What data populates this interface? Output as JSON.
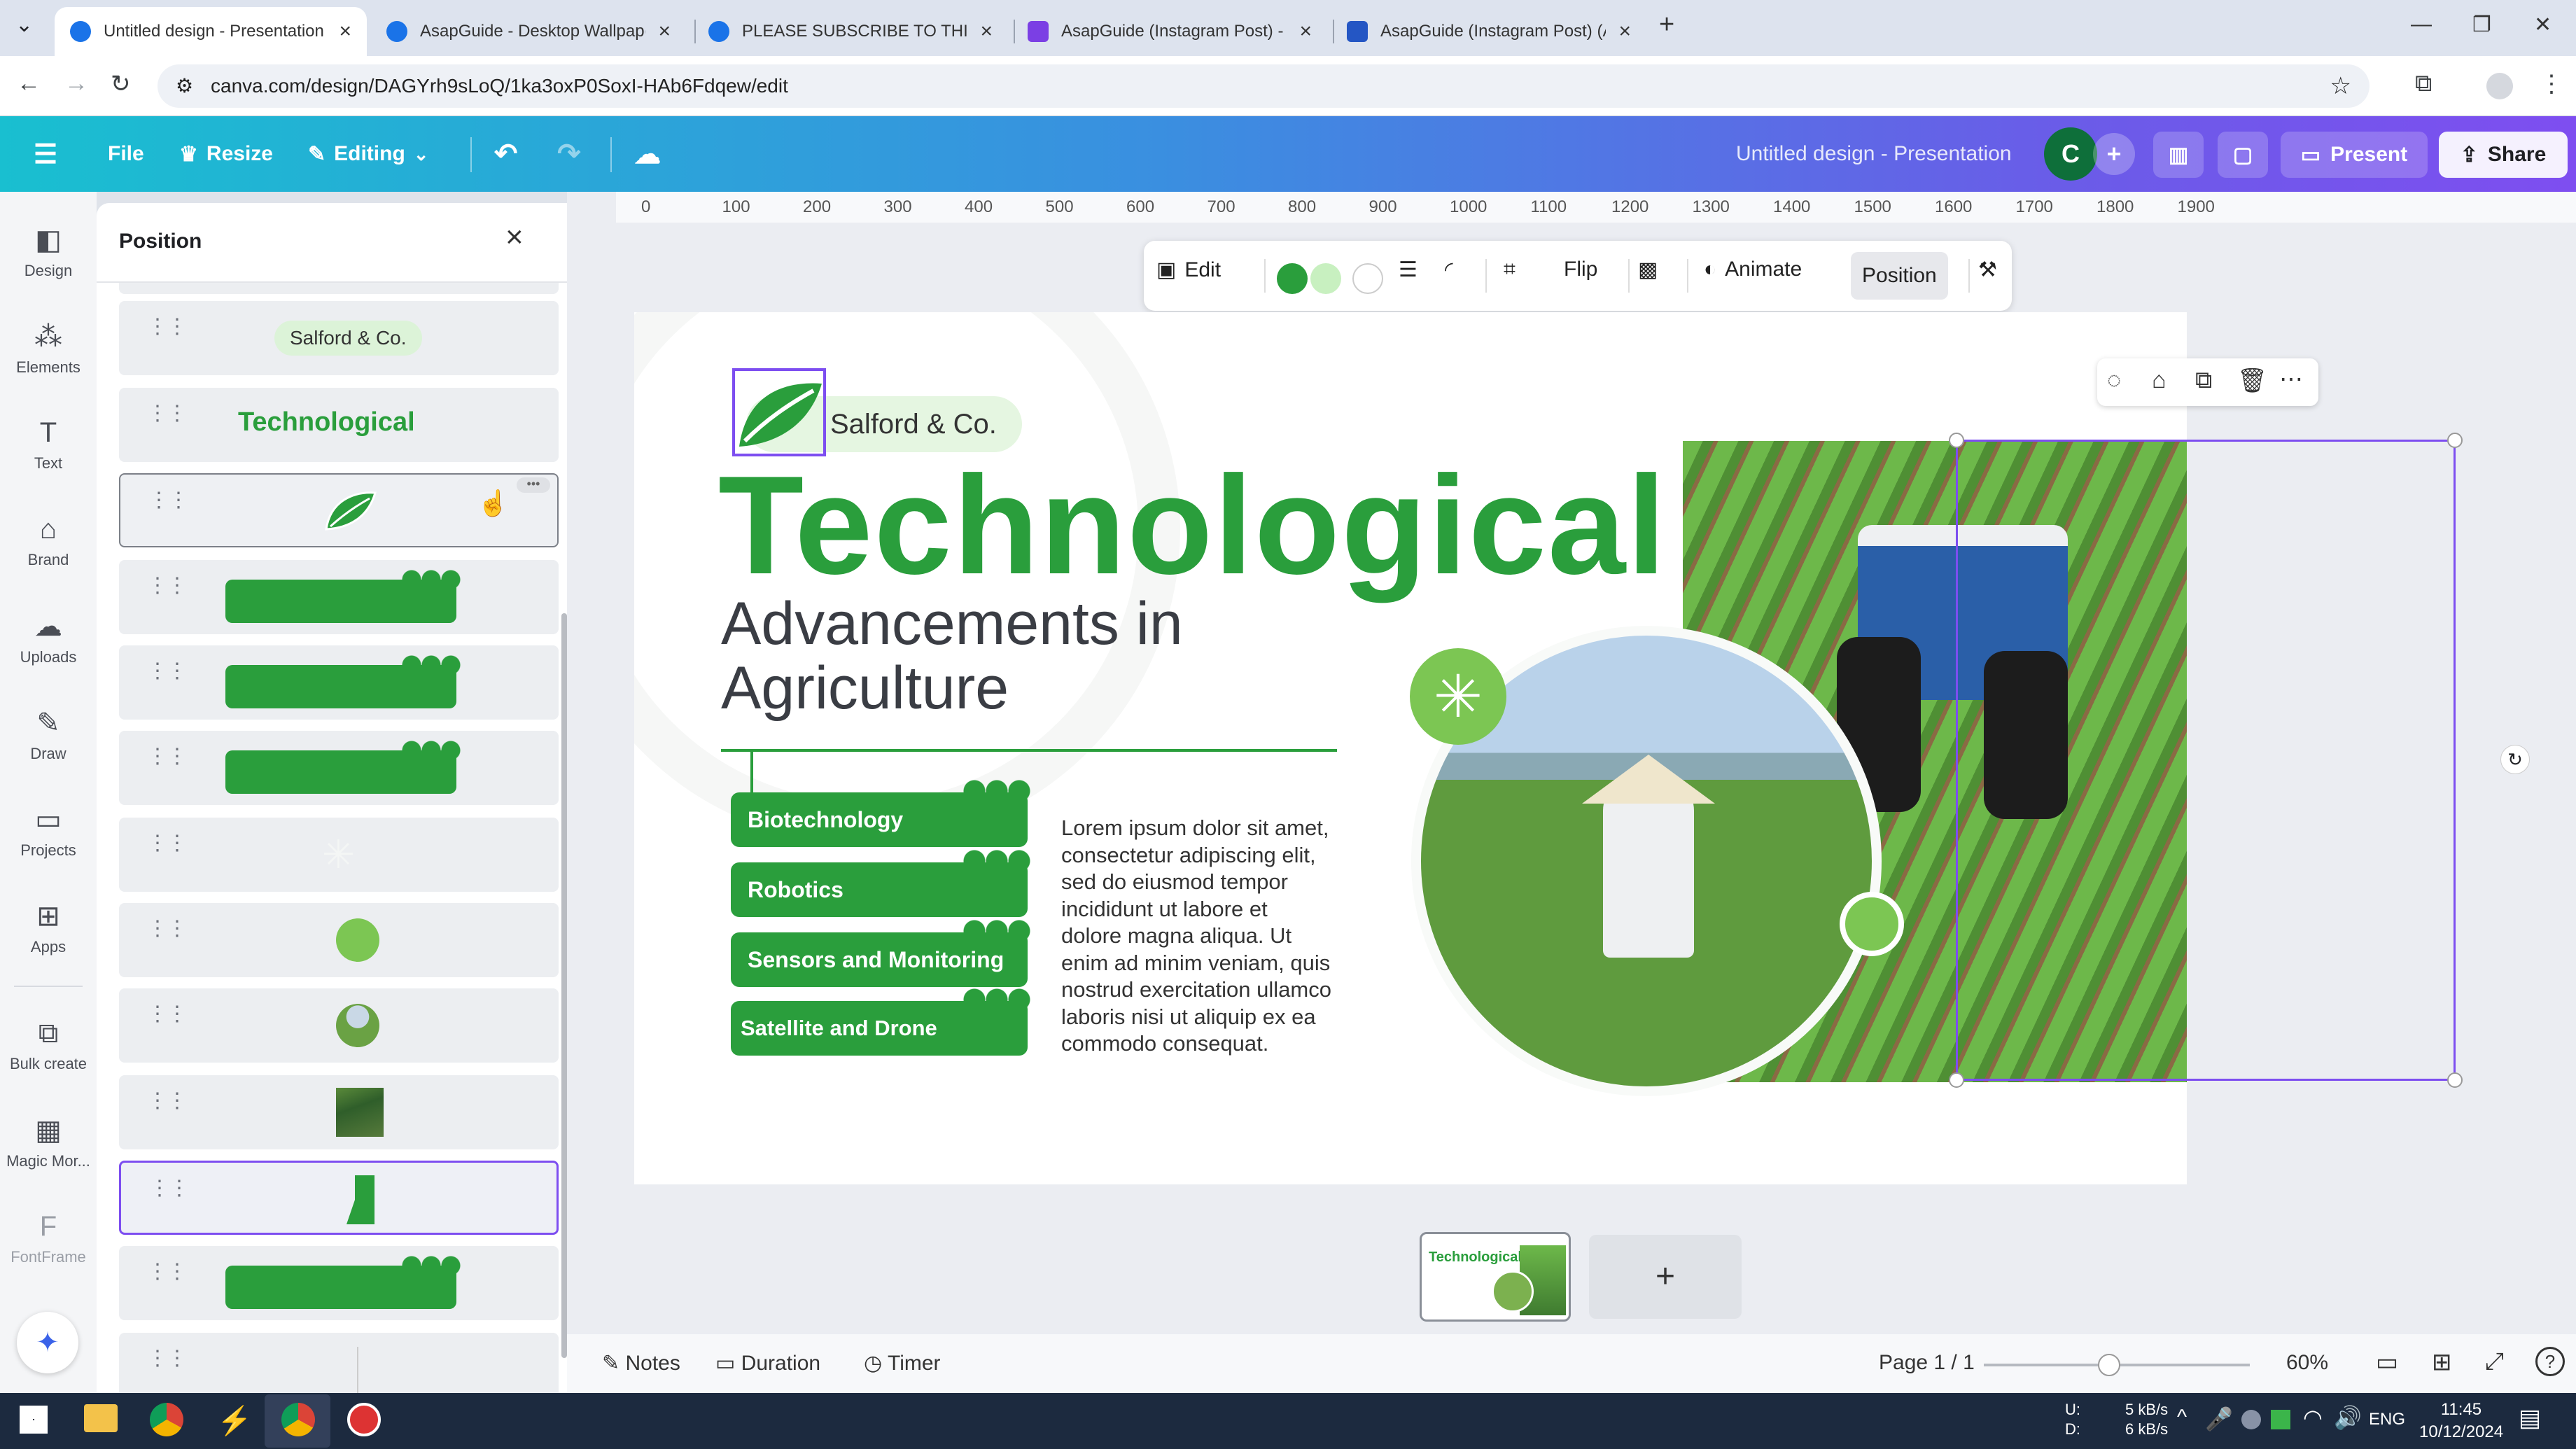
{
  "browser": {
    "tabs": [
      {
        "title": "Untitled design - Presentation",
        "favicon_color": "#1a73e8",
        "active": true
      },
      {
        "title": "AsapGuide - Desktop Wallpape",
        "favicon_color": "#1a73e8"
      },
      {
        "title": "PLEASE SUBSCRIBE TO THIS CH",
        "favicon_color": "#1a73e8"
      },
      {
        "title": "AsapGuide (Instagram Post) - Y",
        "favicon_color": "#7b3fe4"
      },
      {
        "title": "AsapGuide (Instagram Post) (A",
        "favicon_color": "#2456c4"
      }
    ],
    "url": "canva.com/design/DAGYrh9sLoQ/1ka3oxP0SoxI-HAb6Fdqew/edit"
  },
  "header": {
    "file": "File",
    "resize": "Resize",
    "editing": "Editing",
    "doc_title": "Untitled design - Presentation",
    "avatar": "C",
    "present": "Present",
    "share": "Share"
  },
  "sidebar": {
    "items": [
      {
        "label": "Design",
        "icon": "design-icon"
      },
      {
        "label": "Elements",
        "icon": "elements-icon"
      },
      {
        "label": "Text",
        "icon": "text-icon"
      },
      {
        "label": "Brand",
        "icon": "brand-icon"
      },
      {
        "label": "Uploads",
        "icon": "uploads-icon"
      },
      {
        "label": "Draw",
        "icon": "draw-icon"
      },
      {
        "label": "Projects",
        "icon": "projects-icon"
      },
      {
        "label": "Apps",
        "icon": "apps-icon"
      },
      {
        "label": "Bulk create",
        "icon": "bulk-create-icon"
      },
      {
        "label": "Magic Mor...",
        "icon": "magic-morph-icon"
      },
      {
        "label": "FontFrame",
        "icon": "fontframe-icon"
      }
    ]
  },
  "panel": {
    "title": "Position",
    "layers": [
      {
        "kind": "text-pill",
        "label": "Salford & Co."
      },
      {
        "kind": "text-green",
        "label": "Technological"
      },
      {
        "kind": "leaf"
      },
      {
        "kind": "green-bar"
      },
      {
        "kind": "green-bar"
      },
      {
        "kind": "green-bar"
      },
      {
        "kind": "sparkle"
      },
      {
        "kind": "circle"
      },
      {
        "kind": "photo-circle"
      },
      {
        "kind": "photo-rect"
      },
      {
        "kind": "slim-shape"
      },
      {
        "kind": "green-bar"
      },
      {
        "kind": "line"
      }
    ]
  },
  "toolbar": {
    "edit": "Edit",
    "flip": "Flip",
    "animate": "Animate",
    "position": "Position",
    "swatches": [
      "#2a9e3c",
      "#c8f0c0",
      "#ffffff"
    ]
  },
  "ruler": {
    "ticks": [
      "0",
      "100",
      "200",
      "300",
      "400",
      "500",
      "600",
      "700",
      "800",
      "900",
      "1000",
      "1100",
      "1200",
      "1300",
      "1400",
      "1500",
      "1600",
      "1700",
      "1800",
      "1900"
    ]
  },
  "slide": {
    "brand": "Salford & Co.",
    "title": "Technological",
    "subtitle_line1": "Advancements in",
    "subtitle_line2": "Agriculture",
    "pills": [
      "Biotechnology",
      "Robotics",
      "Sensors and Monitoring",
      "Satellite and Drone Mapping"
    ],
    "body": [
      "Lorem ipsum dolor sit amet,",
      "consectetur adipiscing elit,",
      "sed do eiusmod tempor",
      "incididunt ut labore et",
      "dolore magna aliqua. Ut",
      "enim ad minim veniam, quis",
      "nostrud exercitation ullamco",
      "laboris nisi ut aliquip ex ea",
      "commodo consequat."
    ],
    "green": "#2a9e3c"
  },
  "bottom": {
    "notes": "Notes",
    "duration": "Duration",
    "timer": "Timer",
    "page": "Page 1 / 1",
    "zoom": "60%",
    "zoom_level": 0.47
  },
  "taskbar": {
    "net_up": "5 kB/s",
    "net_down": "6 kB/s",
    "net_u": "U:",
    "net_d": "D:",
    "lang": "ENG",
    "time": "11:45",
    "date": "10/12/2024"
  }
}
